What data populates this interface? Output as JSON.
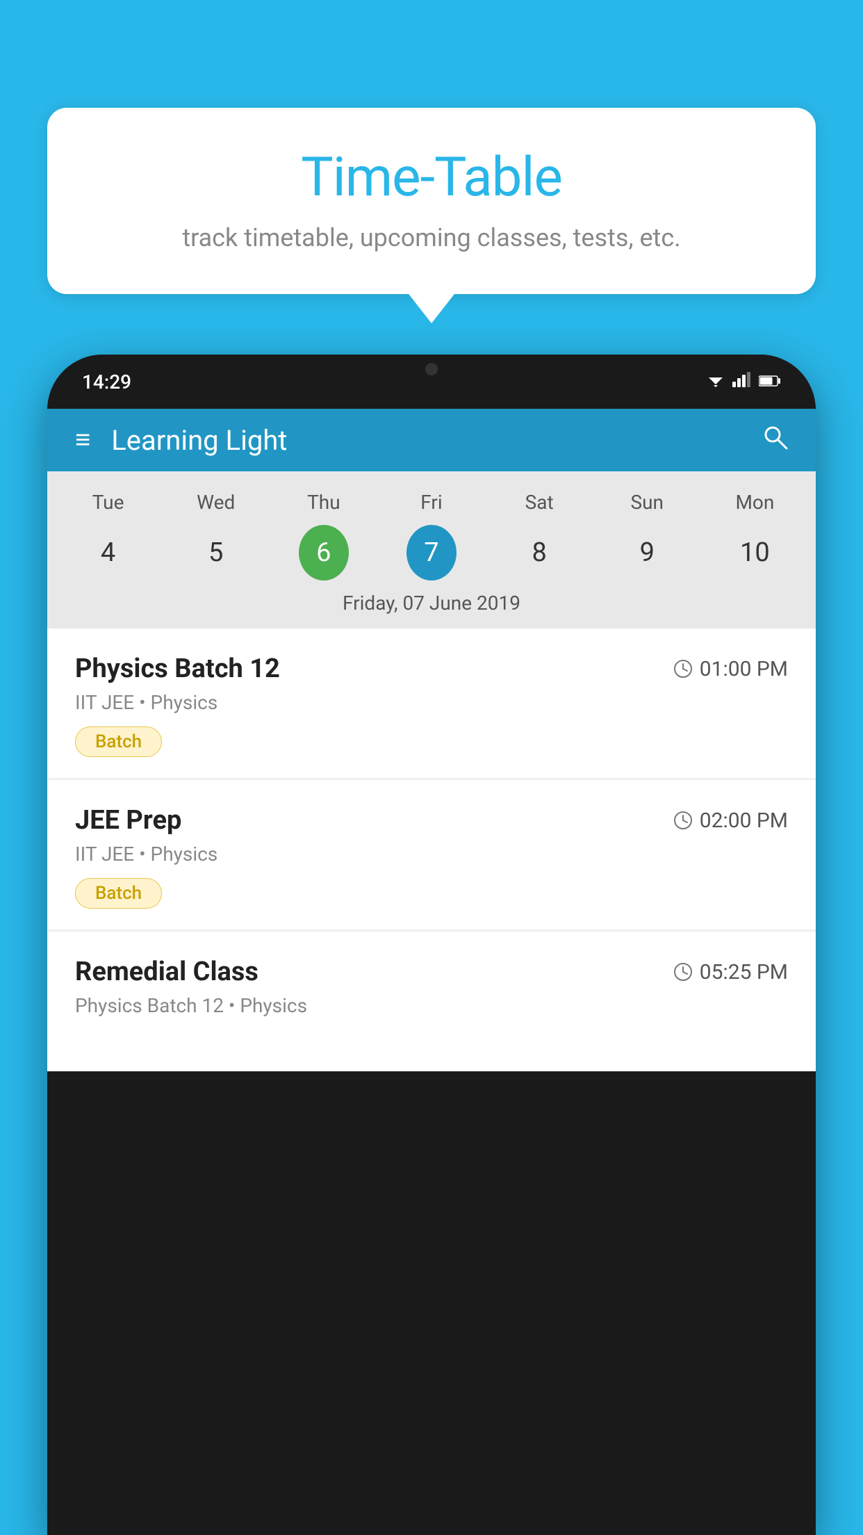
{
  "bubble": {
    "title": "Time-Table",
    "subtitle": "track timetable, upcoming classes, tests, etc."
  },
  "phone": {
    "status_bar": {
      "time": "14:29",
      "wifi": "▼",
      "signal": "▲",
      "battery": "▮"
    },
    "header": {
      "title": "Learning Light",
      "menu_icon": "≡",
      "search_icon": "⌕"
    },
    "calendar": {
      "days": [
        "Tue",
        "Wed",
        "Thu",
        "Fri",
        "Sat",
        "Sun",
        "Mon"
      ],
      "dates": [
        "4",
        "5",
        "6",
        "7",
        "8",
        "9",
        "10"
      ],
      "today_index": 2,
      "selected_index": 3,
      "selected_label": "Friday, 07 June 2019"
    },
    "schedule": [
      {
        "title": "Physics Batch 12",
        "time": "01:00 PM",
        "subtitle": "IIT JEE • Physics",
        "tag": "Batch"
      },
      {
        "title": "JEE Prep",
        "time": "02:00 PM",
        "subtitle": "IIT JEE • Physics",
        "tag": "Batch"
      },
      {
        "title": "Remedial Class",
        "time": "05:25 PM",
        "subtitle": "Physics Batch 12 • Physics",
        "tag": ""
      }
    ]
  }
}
